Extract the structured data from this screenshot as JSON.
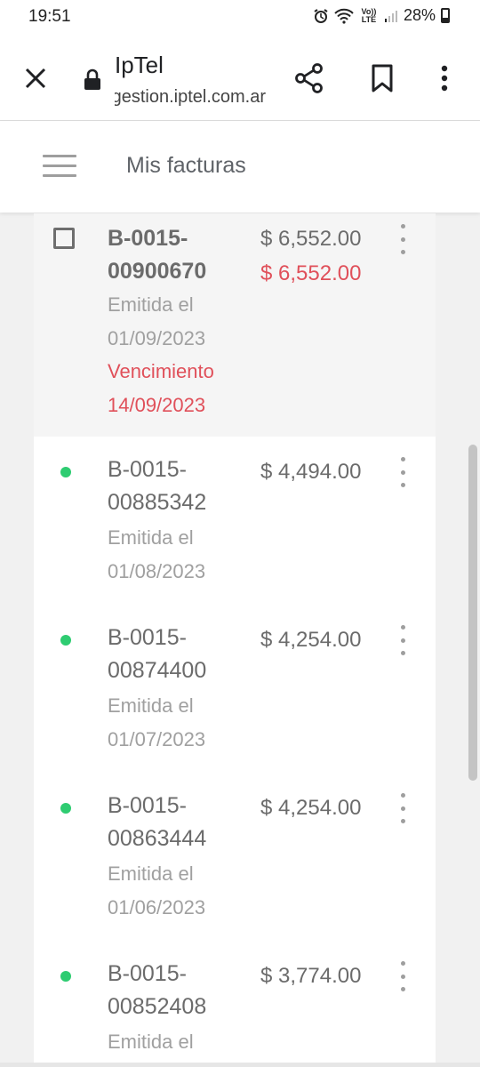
{
  "status_bar": {
    "time": "19:51",
    "network": "Vo)) LTE",
    "battery": "28%"
  },
  "browser": {
    "title": "IpTel",
    "url": "gestion.iptel.com.ar"
  },
  "app": {
    "title": "Mis facturas"
  },
  "invoices": [
    {
      "number_line1": "B-0015-",
      "number_line2": "00900670",
      "issued_label": "Emitida el",
      "issued_date": "01/09/2023",
      "due_label": "Vencimiento",
      "due_date": "14/09/2023",
      "amount": "$ 6,552.00",
      "amount_due": "$ 6,552.00"
    },
    {
      "number_line1": "B-0015-",
      "number_line2": "00885342",
      "issued_label": "Emitida el",
      "issued_date": "01/08/2023",
      "amount": "$ 4,494.00"
    },
    {
      "number_line1": "B-0015-",
      "number_line2": "00874400",
      "issued_label": "Emitida el",
      "issued_date": "01/07/2023",
      "amount": "$ 4,254.00"
    },
    {
      "number_line1": "B-0015-",
      "number_line2": "00863444",
      "issued_label": "Emitida el",
      "issued_date": "01/06/2023",
      "amount": "$ 4,254.00"
    },
    {
      "number_line1": "B-0015-",
      "number_line2": "00852408",
      "issued_label": "Emitida el",
      "amount": "$ 3,774.00"
    }
  ],
  "colors": {
    "paid_dot": "#2ecc71",
    "due_red": "#e0505a"
  }
}
